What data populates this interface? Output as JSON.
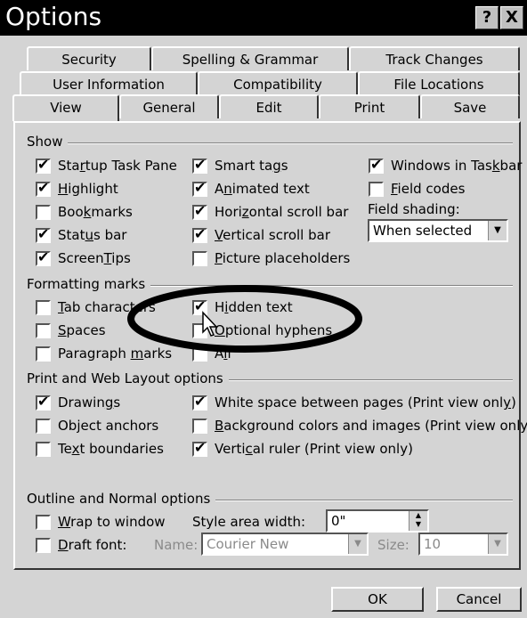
{
  "window": {
    "title": "Options",
    "help_glyph": "?",
    "close_glyph": "X"
  },
  "tabs_row1": [
    "Security",
    "Spelling & Grammar",
    "Track Changes"
  ],
  "tabs_row2": [
    "User Information",
    "Compatibility",
    "File Locations"
  ],
  "tabs_row3": [
    "View",
    "General",
    "Edit",
    "Print",
    "Save"
  ],
  "show": {
    "label": "Show",
    "col1": [
      {
        "pre": "Sta",
        "u": "r",
        "post": "tup Task Pane",
        "checked": true
      },
      {
        "pre": "",
        "u": "H",
        "post": "ighlight",
        "checked": true
      },
      {
        "pre": "Boo",
        "u": "k",
        "post": "marks",
        "checked": false
      },
      {
        "pre": "Stat",
        "u": "u",
        "post": "s bar",
        "checked": true
      },
      {
        "pre": "Screen",
        "u": "T",
        "post": "ips",
        "checked": true
      }
    ],
    "col2": [
      {
        "pre": "Smart ta",
        "u": "g",
        "post": "s",
        "checked": true
      },
      {
        "pre": "A",
        "u": "n",
        "post": "imated text",
        "checked": true
      },
      {
        "pre": "Hori",
        "u": "z",
        "post": "ontal scroll bar",
        "checked": true
      },
      {
        "pre": "",
        "u": "V",
        "post": "ertical scroll bar",
        "checked": true
      },
      {
        "pre": "",
        "u": "P",
        "post": "icture placeholders",
        "checked": false
      }
    ],
    "col3": [
      {
        "pre": "Windows in Tas",
        "u": "k",
        "post": "bar",
        "checked": true
      },
      {
        "pre": "",
        "u": "F",
        "post": "ield codes",
        "checked": false
      }
    ],
    "field_shading_label": "Field shading:",
    "field_shading_value": "When selected"
  },
  "formatting": {
    "label": "Formatting marks",
    "col1": [
      {
        "pre": "",
        "u": "T",
        "post": "ab characters",
        "checked": false
      },
      {
        "pre": "",
        "u": "S",
        "post": "paces",
        "checked": false
      },
      {
        "pre": "Paragraph ",
        "u": "m",
        "post": "arks",
        "checked": false
      }
    ],
    "col2": [
      {
        "pre": "H",
        "u": "i",
        "post": "dden text",
        "checked": true
      },
      {
        "pre": "",
        "u": "O",
        "post": "ptional hyphens",
        "checked": false
      },
      {
        "pre": "A",
        "u": "l",
        "post": "l",
        "checked": false
      }
    ]
  },
  "print_web": {
    "label": "Print and Web Layout options",
    "col1": [
      {
        "pre": "Drawin",
        "u": "g",
        "post": "s",
        "checked": true
      },
      {
        "pre": "Object anchors",
        "u": "",
        "post": "",
        "checked": false
      },
      {
        "pre": "Te",
        "u": "x",
        "post": "t boundaries",
        "checked": false
      }
    ],
    "col2": [
      {
        "pre": "White space between pages (Print view onl",
        "u": "y",
        "post": ")",
        "checked": true
      },
      {
        "pre": "",
        "u": "B",
        "post": "ackground colors and images (Print view only)",
        "checked": false
      },
      {
        "pre": "Verti",
        "u": "c",
        "post": "al ruler (Print view only)",
        "checked": true
      }
    ]
  },
  "outline": {
    "label": "Outline and Normal options",
    "wrap": {
      "pre": "",
      "u": "W",
      "post": "rap to window",
      "checked": false
    },
    "draft": {
      "pre": "",
      "u": "D",
      "post": "raft font:",
      "checked": false
    },
    "style_area_label": "Style area width:",
    "style_area_value": "0\"",
    "name_label": "Name:",
    "name_value": "Courier New",
    "size_label": "Size:",
    "size_value": "10"
  },
  "buttons": {
    "ok": "OK",
    "cancel": "Cancel"
  }
}
